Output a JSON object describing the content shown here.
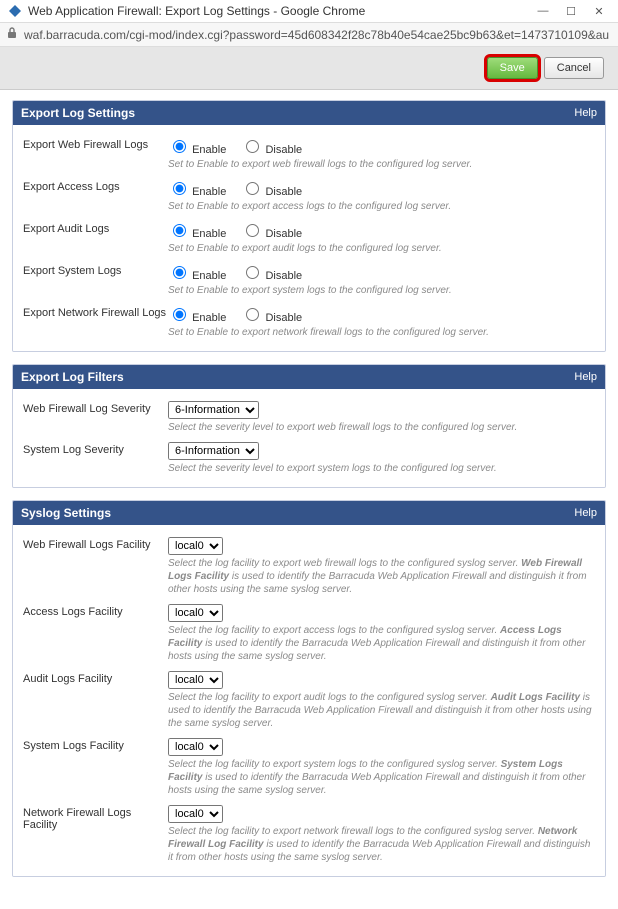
{
  "window": {
    "title": "Web Application Firewall: Export Log Settings - Google Chrome",
    "url": "waf.barracuda.com/cgi-mod/index.cgi?password=45d608342f28c78b40e54cae25bc9b63&et=1473710109&au"
  },
  "buttons": {
    "save": "Save",
    "cancel": "Cancel"
  },
  "radio": {
    "enable": "Enable",
    "disable": "Disable"
  },
  "help_label": "Help",
  "sections": {
    "export_log_settings": {
      "title": "Export Log Settings",
      "rows": {
        "web_firewall": {
          "label": "Export Web Firewall Logs",
          "hint": "Set to Enable to export web firewall logs to the configured log server."
        },
        "access": {
          "label": "Export Access Logs",
          "hint": "Set to Enable to export access logs to the configured log server."
        },
        "audit": {
          "label": "Export Audit Logs",
          "hint": "Set to Enable to export audit logs to the configured log server."
        },
        "system": {
          "label": "Export System Logs",
          "hint": "Set to Enable to export system logs to the configured log server."
        },
        "network_firewall": {
          "label": "Export Network Firewall Logs",
          "hint": "Set to Enable to export network firewall logs to the configured log server."
        }
      }
    },
    "export_log_filters": {
      "title": "Export Log Filters",
      "web_severity": {
        "label": "Web Firewall Log Severity",
        "value": "6-Information",
        "hint": "Select the severity level to export web firewall logs to the configured log server."
      },
      "system_severity": {
        "label": "System Log Severity",
        "value": "6-Information",
        "hint": "Select the severity level to export system logs to the configured log server."
      }
    },
    "syslog_settings": {
      "title": "Syslog Settings",
      "facilities": {
        "web": {
          "label": "Web Firewall Logs Facility",
          "value": "local0",
          "hint_pre": "Select the log facility to export web firewall logs to the configured syslog server. ",
          "hint_bold": "Web Firewall Logs Facility",
          "hint_post": " is used to identify the Barracuda Web Application Firewall and distinguish it from other hosts using the same syslog server."
        },
        "access": {
          "label": "Access Logs Facility",
          "value": "local0",
          "hint_pre": "Select the log facility to export access logs to the configured syslog server. ",
          "hint_bold": "Access Logs Facility",
          "hint_post": " is used to identify the Barracuda Web Application Firewall and distinguish it from other hosts using the same syslog server."
        },
        "audit": {
          "label": "Audit Logs Facility",
          "value": "local0",
          "hint_pre": "Select the log facility to export audit logs to the configured syslog server. ",
          "hint_bold": "Audit Logs Facility",
          "hint_post": " is used to identify the Barracuda Web Application Firewall and distinguish it from other hosts using the same syslog server."
        },
        "system": {
          "label": "System Logs Facility",
          "value": "local0",
          "hint_pre": "Select the log facility to export system logs to the configured syslog server. ",
          "hint_bold": "System Logs Facility",
          "hint_post": " is used to identify the Barracuda Web Application Firewall and distinguish it from other hosts using the same syslog server."
        },
        "network": {
          "label": "Network Firewall Logs Facility",
          "value": "local0",
          "hint_pre": "Select the log facility to export network firewall logs to the configured syslog server. ",
          "hint_bold": "Network Firewall Log Facility",
          "hint_post": " is used to identify the Barracuda Web Application Firewall and distinguish it from other hosts using the same syslog server."
        }
      }
    }
  }
}
